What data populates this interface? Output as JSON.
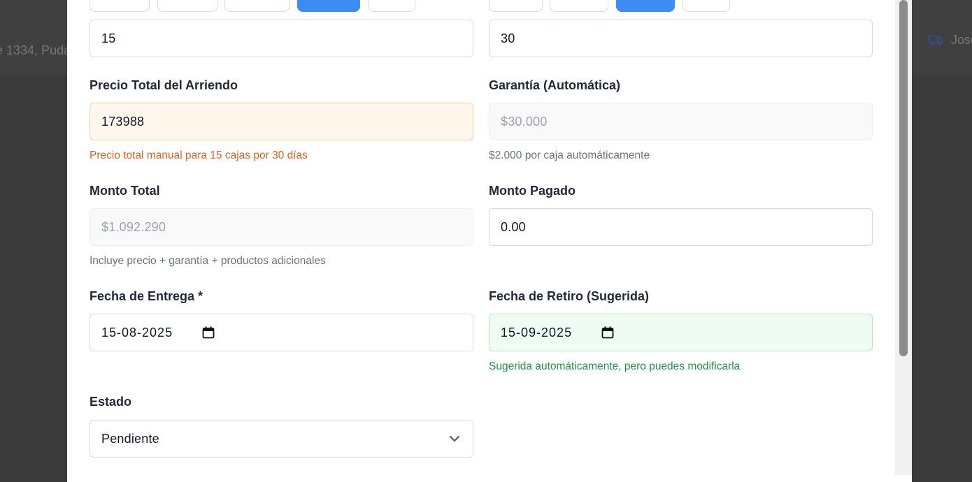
{
  "background": {
    "address_fragment": "e 1334, Puda",
    "user_name_fragment": "Jose",
    "user_icon": "truck-icon"
  },
  "form": {
    "quantity_value": "15",
    "days_value": "30",
    "total_price": {
      "label": "Precio Total del Arriendo",
      "value": "173988",
      "help": "Precio total manual para 15 cajas por 30 días"
    },
    "guarantee": {
      "label": "Garantía (Automática)",
      "value": "$30.000",
      "help": "$2.000 por caja automáticamente"
    },
    "total_amount": {
      "label": "Monto Total",
      "value": "$1.092.290",
      "help": "Incluye precio + garantía + productos adicionales"
    },
    "paid_amount": {
      "label": "Monto Pagado",
      "value": "0.00"
    },
    "delivery_date": {
      "label": "Fecha de Entrega *",
      "value": "15-08-2025"
    },
    "pickup_date": {
      "label": "Fecha de Retiro (Sugerida)",
      "value": "15-09-2025",
      "help": "Sugerida automáticamente, pero puedes modificarla"
    },
    "status": {
      "label": "Estado",
      "selected": "Pendiente"
    }
  },
  "colors": {
    "accent": "#3d8bf5",
    "warning_text": "#dd5f1f",
    "success_text": "#1f9445"
  }
}
